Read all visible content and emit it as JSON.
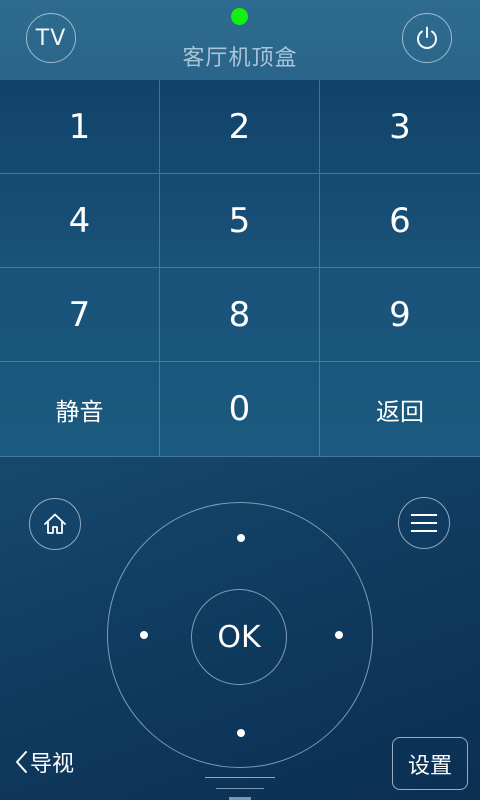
{
  "header": {
    "tv_label": "TV",
    "title": "客厅机顶盒",
    "status_color": "#14f014",
    "power_icon": "power-icon"
  },
  "keypad": {
    "keys": [
      "1",
      "2",
      "3",
      "4",
      "5",
      "6",
      "7",
      "8",
      "9",
      "静音",
      "0",
      "返回"
    ]
  },
  "navigation": {
    "home_icon": "home-icon",
    "menu_icon": "menu-icon",
    "ok_label": "OK"
  },
  "footer": {
    "guide_label": "导视",
    "settings_label": "设置"
  }
}
